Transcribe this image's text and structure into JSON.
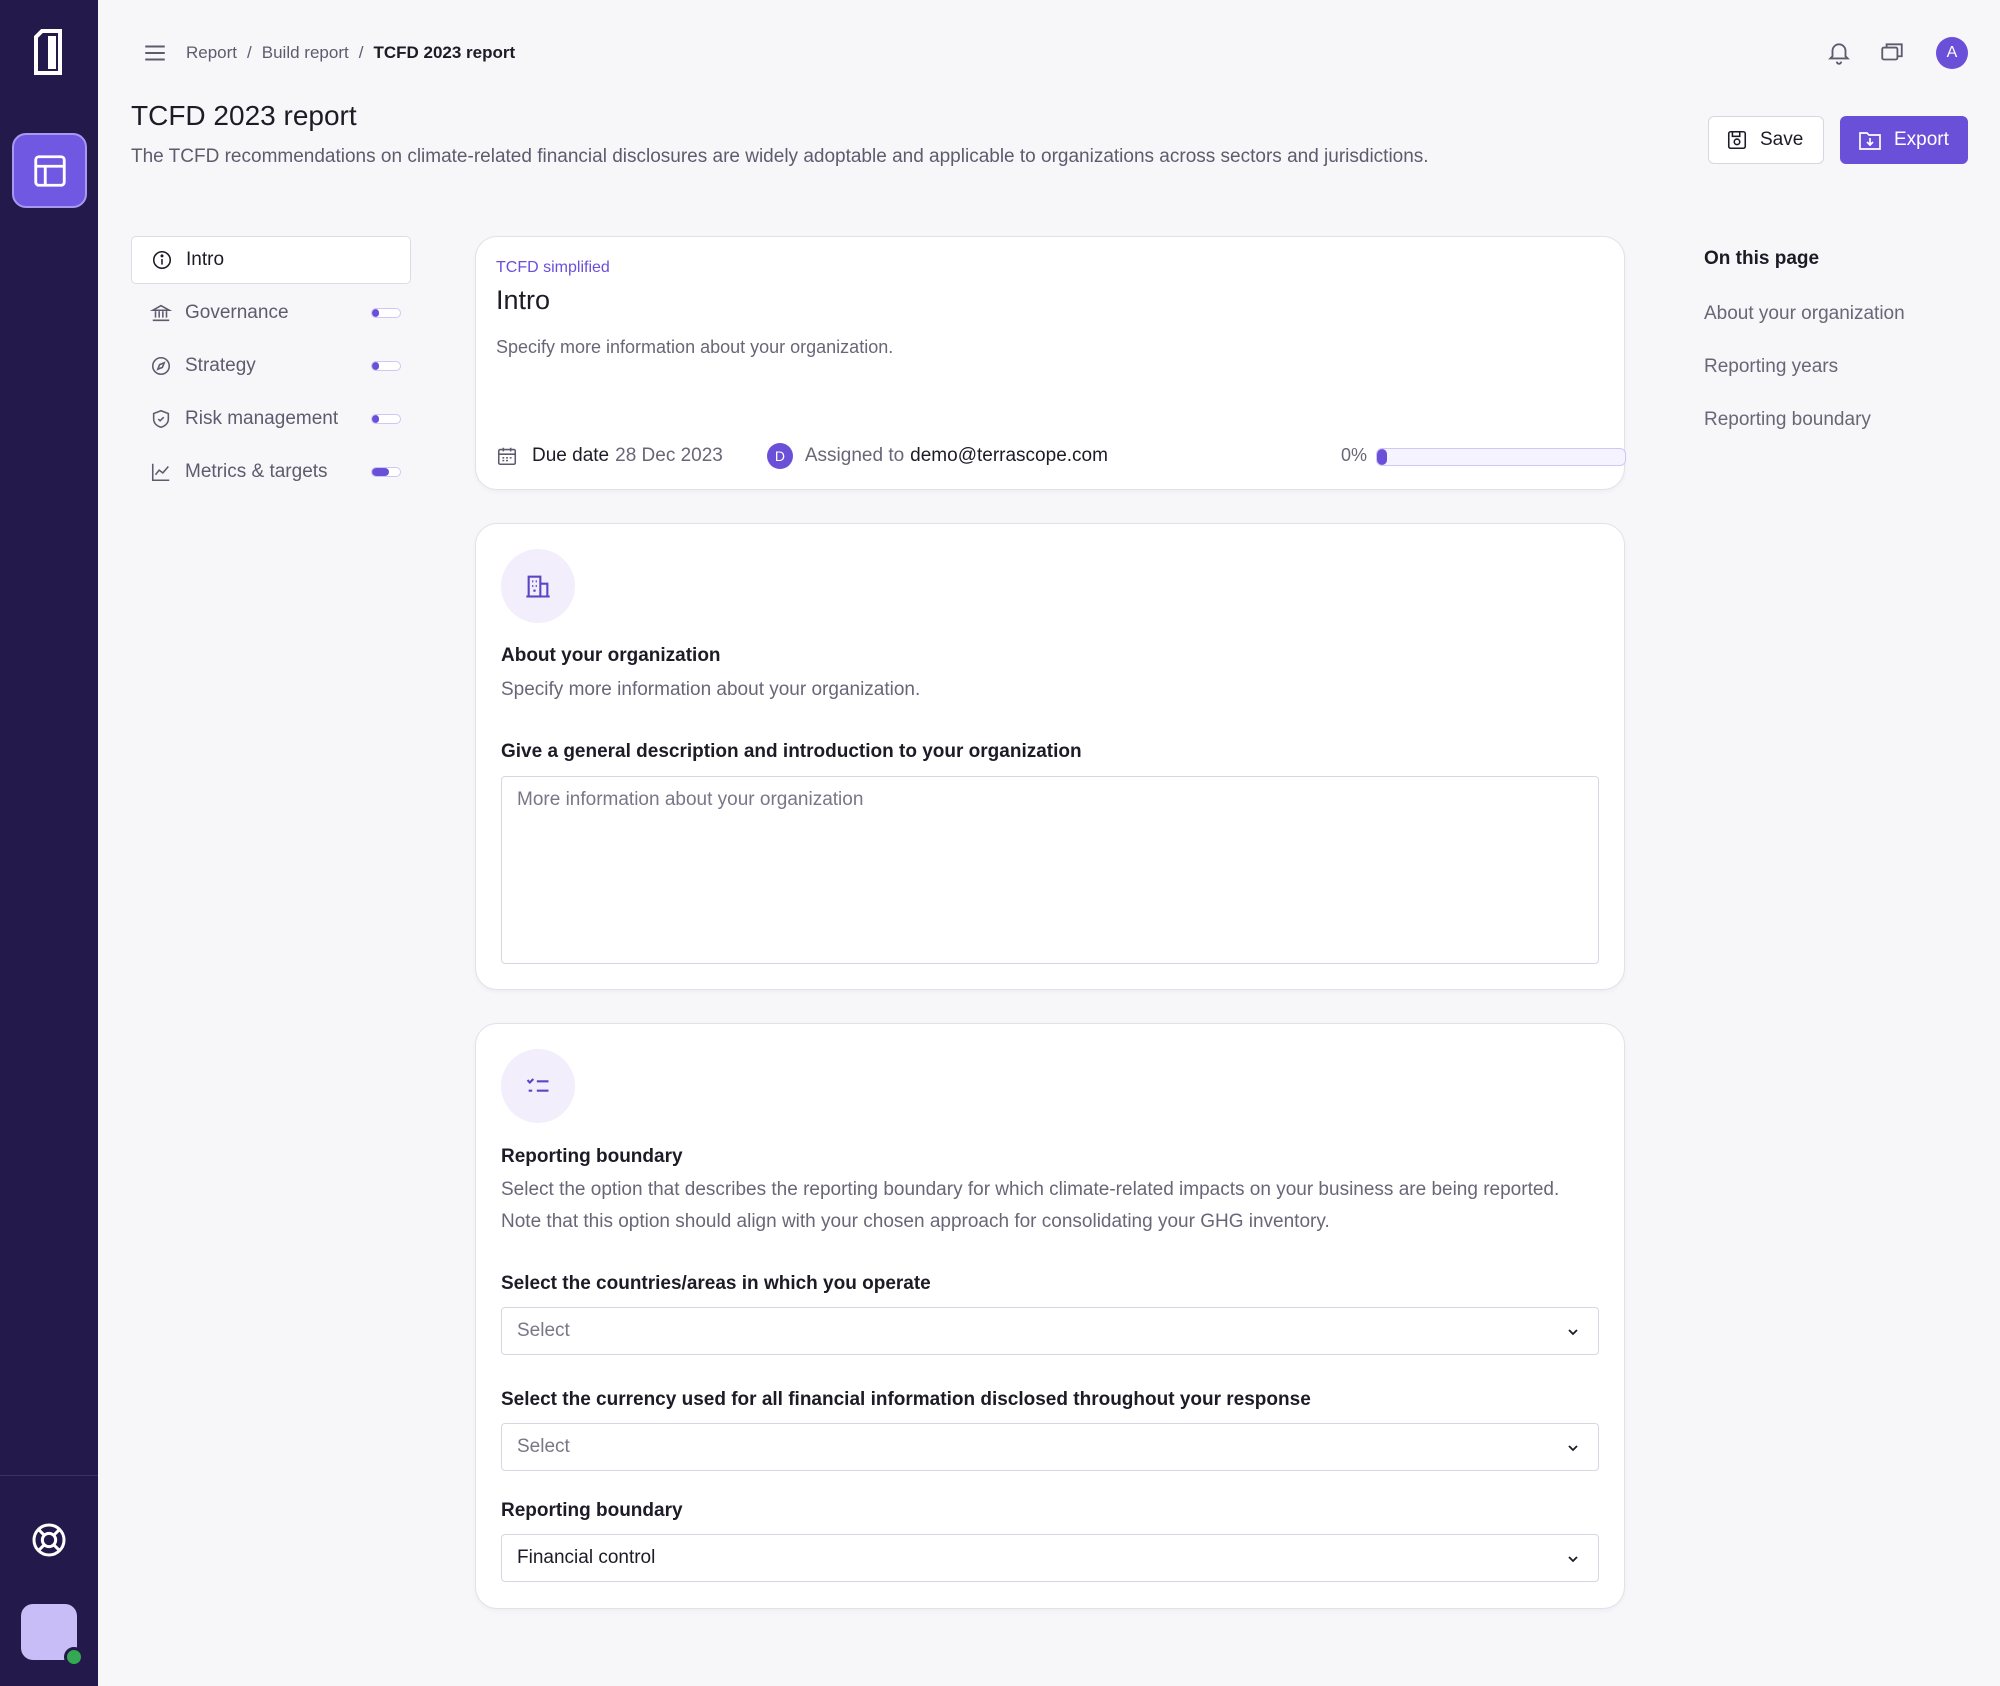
{
  "breadcrumb": [
    "Report",
    "Build report",
    "TCFD 2023 report"
  ],
  "breadcrumb_sep": "/",
  "avatar_initial": "A",
  "page": {
    "title": "TCFD 2023 report",
    "description": "The TCFD recommendations on climate-related financial disclosures are widely adoptable and applicable to organizations across sectors and jurisdictions."
  },
  "actions": {
    "save_label": "Save",
    "export_label": "Export"
  },
  "sections": [
    {
      "label": "Intro",
      "icon": "info-icon",
      "active": true
    },
    {
      "label": "Governance",
      "icon": "bank-icon",
      "progress": 0.1
    },
    {
      "label": "Strategy",
      "icon": "compass-icon",
      "progress": 0.1
    },
    {
      "label": "Risk management",
      "icon": "shield-icon",
      "progress": 0.1
    },
    {
      "label": "Metrics & targets",
      "icon": "chart-line-icon",
      "progress": 0.6
    }
  ],
  "intro": {
    "eyebrow": "TCFD simplified",
    "title": "Intro",
    "description": "Specify more information about your organization.",
    "due_label": "Due date",
    "due_value": "28 Dec 2023",
    "assignee_initial": "D",
    "assigned_label": "Assigned to",
    "assignee": "demo@terrascope.com",
    "progress_text": "0%",
    "progress": 0
  },
  "org": {
    "icon": "building-icon",
    "title": "About your organization",
    "description": "Specify more information about your organization.",
    "field_label": "Give a general description and introduction to your organization",
    "placeholder": "More information about your organization",
    "value": ""
  },
  "boundary": {
    "icon": "checklist-icon",
    "title": "Reporting boundary",
    "description": "Select the option that describes the reporting boundary for which climate-related impacts on your business are being reported. Note that this option should align with your chosen approach for consolidating your GHG inventory.",
    "fields": [
      {
        "label": "Select the countries/areas in which you operate",
        "value": "Select"
      },
      {
        "label": "Select the currency used for all financial information disclosed throughout your response",
        "value": "Select"
      },
      {
        "label": "Reporting boundary",
        "value": "Financial control"
      }
    ]
  },
  "toc": {
    "title": "On this page",
    "items": [
      "About your organization",
      "Reporting years",
      "Reporting boundary"
    ]
  },
  "colors": {
    "accent": "#6a4fd8",
    "rail": "#23194a",
    "status_online": "#34a853"
  }
}
